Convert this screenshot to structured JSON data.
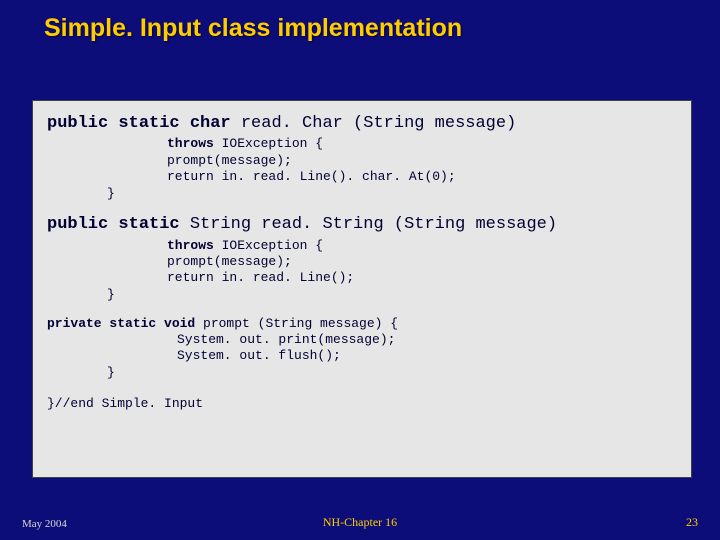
{
  "title": "Simple. Input class implementation",
  "method1": {
    "sig_prefix": "public static char ",
    "sig_name": "read. Char (String message)",
    "l1_kw": "throws",
    "l1_rest": " IOException {",
    "l2": "prompt(message);",
    "l3": "return in. read. Line(). char. At(0);",
    "close": "}"
  },
  "method2": {
    "sig_prefix": "public static ",
    "sig_name": "String read. String (String message)",
    "l1_kw": "throws",
    "l1_rest": " IOException {",
    "l2": "prompt(message);",
    "l3": "return in. read. Line();",
    "close": "}"
  },
  "method3": {
    "sig_kw1": "private static void ",
    "sig_name": "prompt (String message) {",
    "l1": "System. out. print(message);",
    "l2": "System. out. flush();",
    "close": "}"
  },
  "endline": "}//end Simple. Input",
  "footer": {
    "left": "May 2004",
    "center": "NH-Chapter 16",
    "right": "23"
  }
}
